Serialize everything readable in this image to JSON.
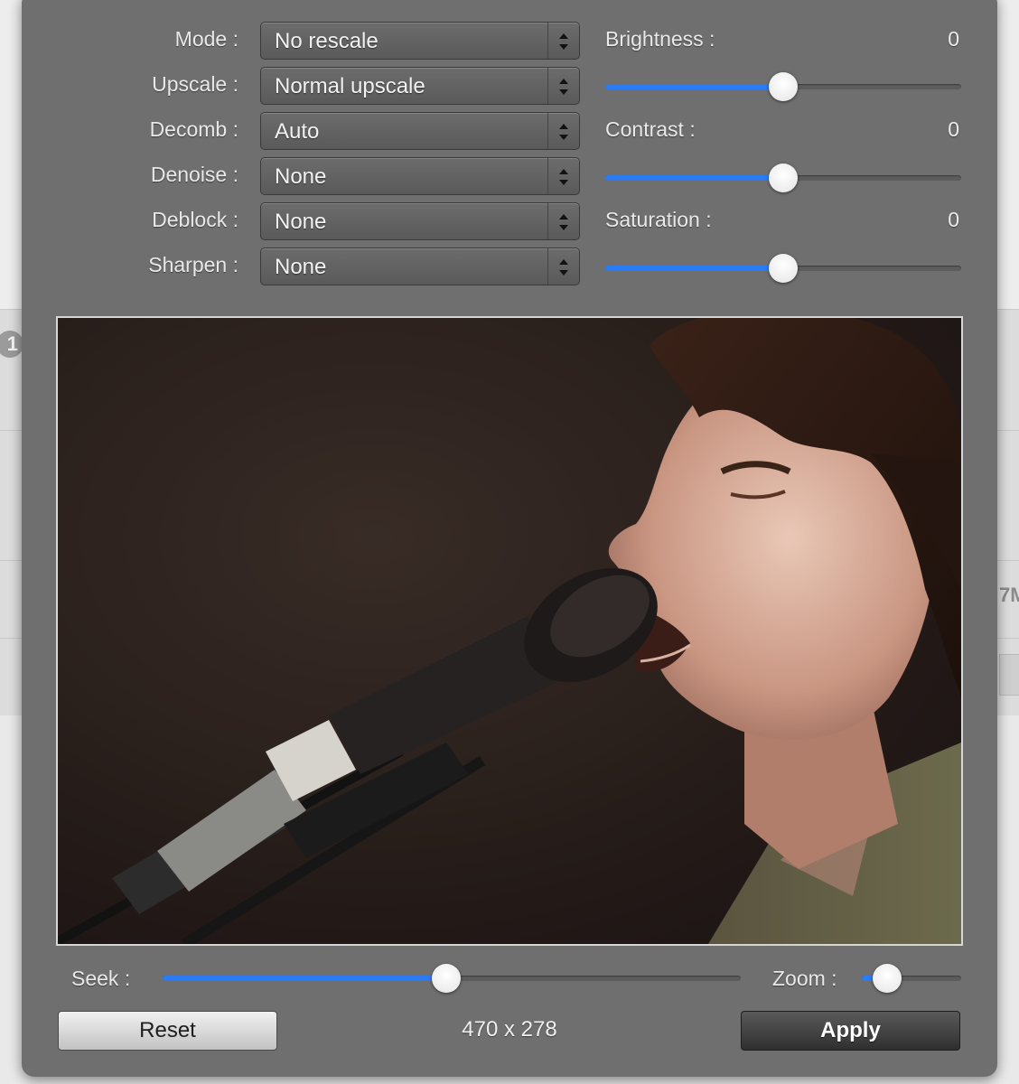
{
  "filters": [
    {
      "label": "Mode :",
      "value": "No rescale"
    },
    {
      "label": "Upscale :",
      "value": "Normal upscale"
    },
    {
      "label": "Decomb :",
      "value": "Auto"
    },
    {
      "label": "Denoise :",
      "value": "None"
    },
    {
      "label": "Deblock :",
      "value": "None"
    },
    {
      "label": "Sharpen :",
      "value": "None"
    }
  ],
  "adjustments": [
    {
      "label": "Brightness :",
      "value": "0",
      "slider_fraction": 0.5
    },
    {
      "label": "Contrast :",
      "value": "0",
      "slider_fraction": 0.5
    },
    {
      "label": "Saturation :",
      "value": "0",
      "slider_fraction": 0.5
    }
  ],
  "seek": {
    "label": "Seek :",
    "fraction": 0.49
  },
  "zoom": {
    "label": "Zoom :",
    "fraction": 0.25
  },
  "preview": {
    "dimensions": "470 x 278"
  },
  "buttons": {
    "reset": "Reset",
    "apply": "Apply"
  },
  "background": {
    "badge": "1",
    "side_text": "7M"
  },
  "colors": {
    "accent": "#2a7bf4",
    "panel": "#6f6f6f"
  }
}
